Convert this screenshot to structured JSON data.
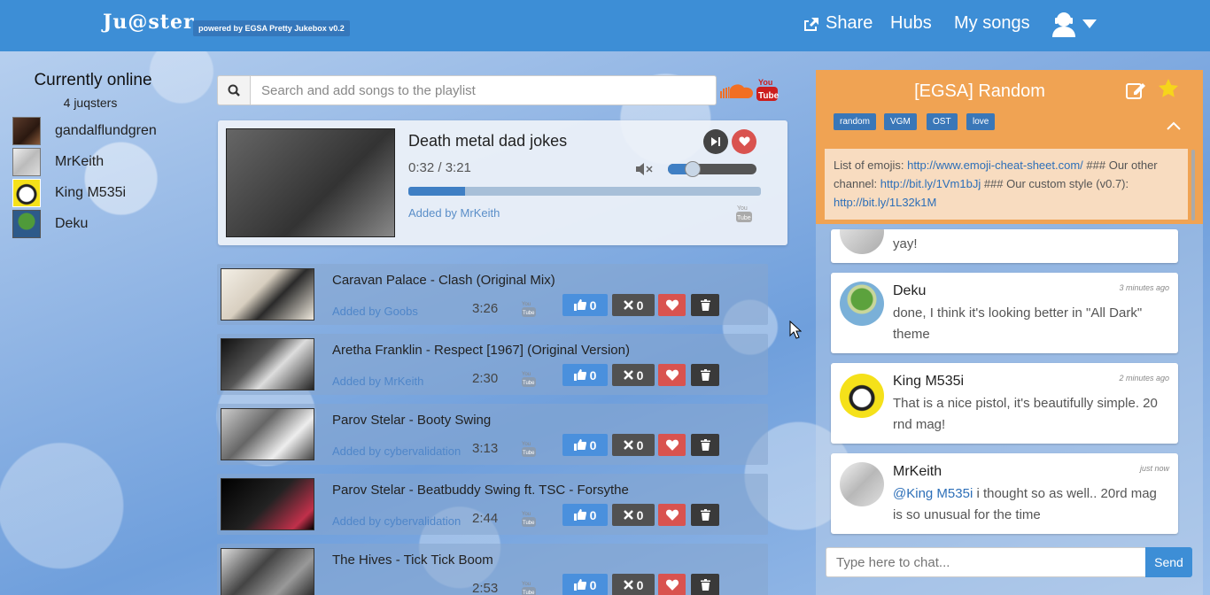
{
  "header": {
    "logo": "Ju@ster",
    "powered": "powered by EGSA Pretty Jukebox v0.2",
    "share": "Share",
    "hubs": "Hubs",
    "my_songs": "My songs"
  },
  "online": {
    "title": "Currently online",
    "count": "4 juqsters",
    "users": [
      "gandalflundgren",
      "MrKeith",
      "King M535i",
      "Deku"
    ]
  },
  "search": {
    "placeholder": "Search and add songs to the playlist"
  },
  "now_playing": {
    "title": "Death metal dad jokes",
    "time": "0:32 / 3:21",
    "added_by": "Added by MrKeith",
    "progress": 0.16,
    "volume": 0.28
  },
  "playlist": [
    {
      "title": "Caravan Palace - Clash (Original Mix)",
      "added_by": "Added by Goobs",
      "duration": "3:26",
      "likes": "0",
      "skips": "0"
    },
    {
      "title": "Aretha Franklin - Respect [1967] (Original Version)",
      "added_by": "Added by MrKeith",
      "duration": "2:30",
      "likes": "0",
      "skips": "0"
    },
    {
      "title": "Parov Stelar - Booty Swing",
      "added_by": "Added by cybervalidation",
      "duration": "3:13",
      "likes": "0",
      "skips": "0"
    },
    {
      "title": "Parov Stelar - Beatbuddy Swing ft. TSC - Forsythe",
      "added_by": "Added by cybervalidation",
      "duration": "2:44",
      "likes": "0",
      "skips": "0"
    },
    {
      "title": "The Hives - Tick Tick Boom",
      "added_by": "",
      "duration": "2:53",
      "likes": "0",
      "skips": "0"
    }
  ],
  "chat": {
    "room": "[EGSA] Random",
    "tags": [
      "random",
      "VGM",
      "OST",
      "love"
    ],
    "desc_1": "List of emojis: ",
    "link_1": "http://www.emoji-cheat-sheet.com/",
    "desc_2": " ### Our other channel: ",
    "link_2": "http://bit.ly/1Vm1bJj",
    "desc_3": " ### Our custom style (v0.7): ",
    "link_3": "http://bit.ly/1L32k1M",
    "messages": [
      {
        "name": "",
        "time": "",
        "text": "yay!"
      },
      {
        "name": "Deku",
        "time": "3 minutes ago",
        "text": "done, I think it's looking better in \"All Dark\" theme"
      },
      {
        "name": "King M535i",
        "time": "2 minutes ago",
        "text": "That is a nice pistol, it's beautifully simple. 20 rnd mag!"
      },
      {
        "name": "MrKeith",
        "time": "just now",
        "mention": "@King M535i",
        "text": " i thought so as well.. 20rd mag is so unusual for the time"
      }
    ],
    "input_placeholder": "Type here to chat...",
    "send": "Send"
  },
  "colors": {
    "header": "#3d8ed6",
    "chat_header": "#f0a353",
    "like": "#4a90dd",
    "fav": "#d9534f"
  },
  "icons": {
    "search": "search-icon",
    "share": "share-icon",
    "user": "user-icon",
    "edit": "edit-icon",
    "star": "star-icon",
    "soundcloud": "soundcloud-icon",
    "youtube": "youtube-icon"
  }
}
